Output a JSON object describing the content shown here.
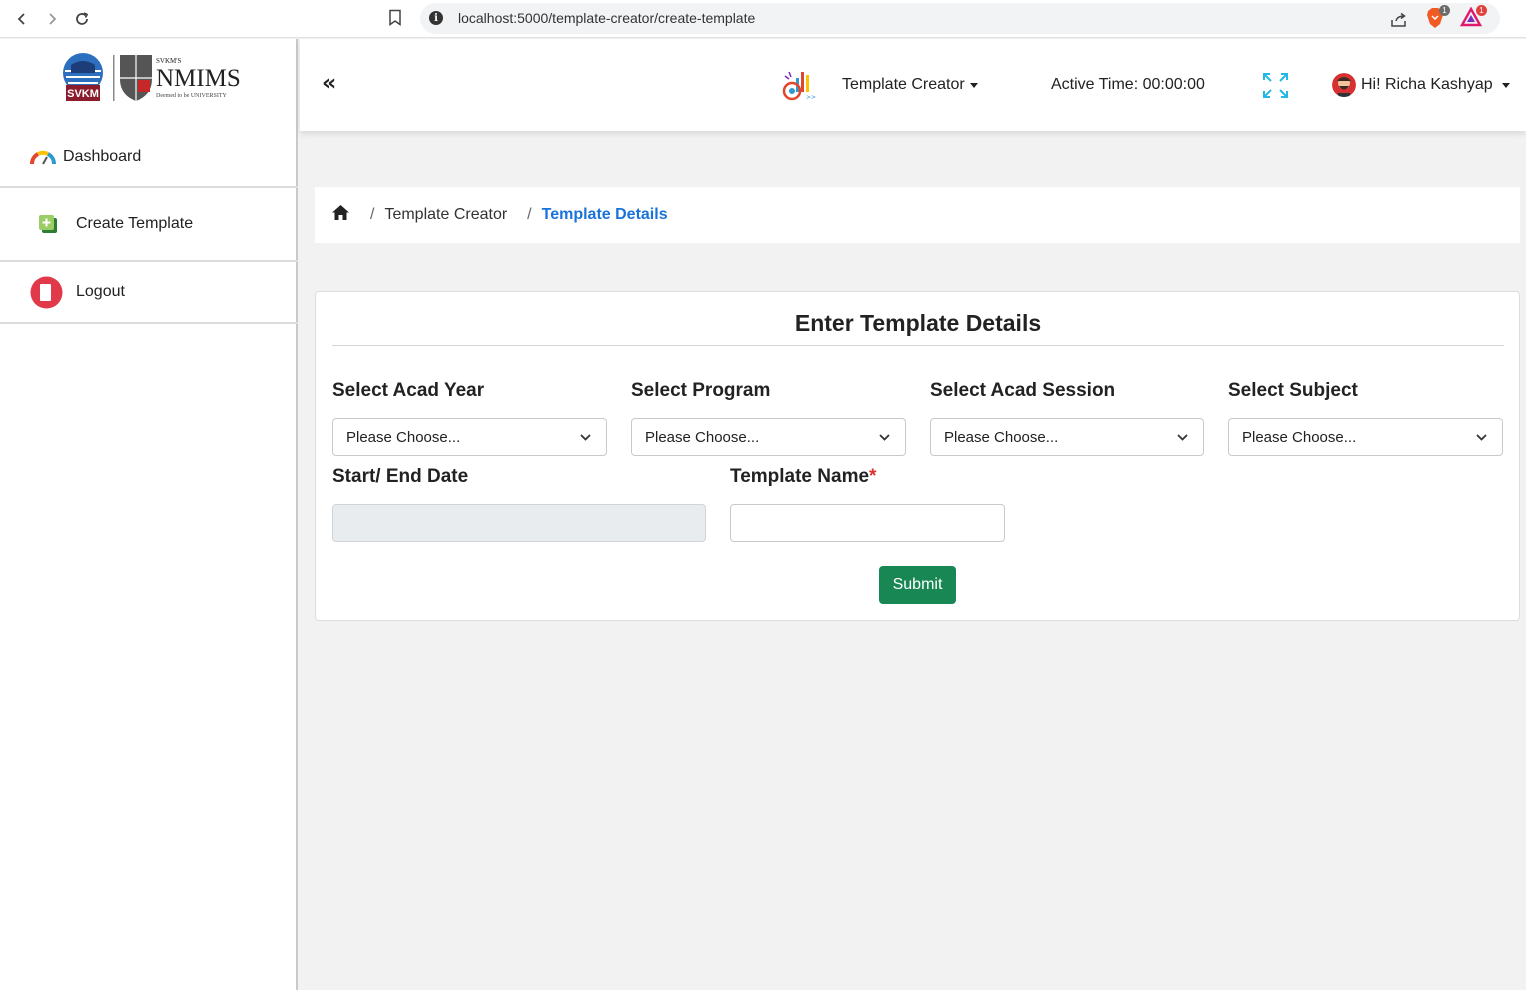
{
  "browser": {
    "url": "localhost:5000/template-creator/create-template",
    "info_glyph": "i",
    "brave_badge": "1",
    "rewards_badge": "1"
  },
  "sidebar": {
    "logo": {
      "svkm_text": "SVKM",
      "brand_small": "SVKM'S",
      "brand": "NMIMS",
      "tagline": "Deemed to be UNIVERSITY"
    },
    "items": [
      {
        "label": "Dashboard",
        "icon": "gauge-icon"
      },
      {
        "label": "Create Template",
        "icon": "add-template-icon"
      },
      {
        "label": "Logout",
        "icon": "logout-icon"
      }
    ]
  },
  "header": {
    "collapse_glyph": "«",
    "menu_label": "Template Creator",
    "active_time": "Active Time: 00:00:00",
    "user_greeting": "Hi! Richa Kashyap"
  },
  "breadcrumb": {
    "items": [
      "Template Creator",
      "Template Details"
    ],
    "separator": "/"
  },
  "form": {
    "title": "Enter Template Details",
    "acad_year": {
      "label": "Select Acad Year",
      "value": "Please Choose..."
    },
    "program": {
      "label": "Select Program",
      "value": "Please Choose..."
    },
    "acad_session": {
      "label": "Select Acad Session",
      "value": "Please Choose..."
    },
    "subject": {
      "label": "Select Subject",
      "value": "Please Choose..."
    },
    "dates": {
      "label": "Start/ End Date",
      "value": ""
    },
    "template_name": {
      "label": "Template Name",
      "required_mark": "*",
      "value": ""
    },
    "submit_label": "Submit"
  },
  "colors": {
    "accent": "#1a73d9",
    "submit": "#198754",
    "required": "#d9302c",
    "fullscreen_icon": "#22b8e8"
  }
}
